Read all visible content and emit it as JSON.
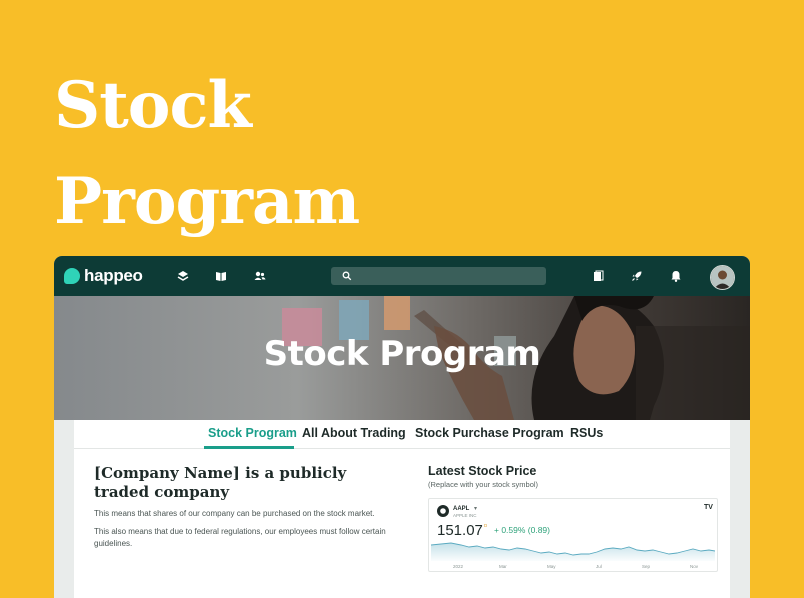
{
  "hero": {
    "title_line1": "Stock",
    "title_line2": "Program"
  },
  "topbar": {
    "logo_text": "happeo",
    "nav_icons": [
      "layers-icon",
      "book-icon",
      "people-icon"
    ],
    "right_icons": [
      "pages-icon",
      "rocket-icon",
      "bell-icon"
    ],
    "search": {
      "placeholder": ""
    }
  },
  "banner": {
    "title": "Stock Program"
  },
  "tabs": [
    {
      "label": "Stock Program",
      "active": true
    },
    {
      "label": "All About Trading",
      "active": false
    },
    {
      "label": "Stock Purchase Program",
      "active": false
    },
    {
      "label": "RSUs",
      "active": false
    }
  ],
  "content": {
    "heading": "[Company Name] is a publicly traded company",
    "paragraph1": "This means that shares of our company can be purchased on the stock market.",
    "paragraph2": "This also means that due to federal regulations, our employees must follow certain guidelines."
  },
  "stock": {
    "title": "Latest Stock Price",
    "subtitle": "(Replace with your stock symbol)",
    "symbol": "AAPL",
    "company": "APPLE INC",
    "price": "151.07",
    "currency_mark": "D",
    "change": "+ 0.59% (0.89)",
    "axis_labels": [
      "2022",
      "Mar",
      "May",
      "Jul",
      "Sep",
      "Nov"
    ],
    "colors": {
      "line": "#5AAAC0",
      "change": "#2EA27A",
      "accent": "#1A9E8A",
      "background": "#F8BE28"
    }
  }
}
